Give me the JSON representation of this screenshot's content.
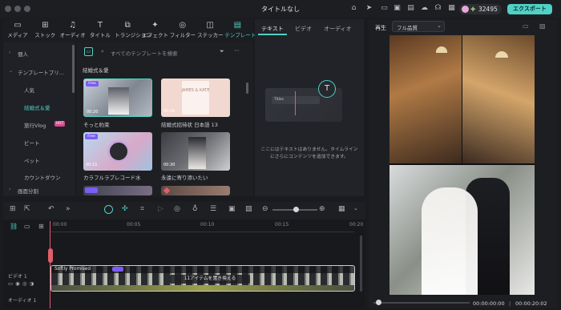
{
  "app": {
    "title": "タイトルなし",
    "credits": "32495",
    "export_label": "エクスポート"
  },
  "toolbar": {
    "items": [
      {
        "label": "メディア",
        "icon": "media-icon"
      },
      {
        "label": "ストック",
        "icon": "stock-icon"
      },
      {
        "label": "オーディオ",
        "icon": "audio-icon"
      },
      {
        "label": "タイトル",
        "icon": "title-icon"
      },
      {
        "label": "トランジション",
        "icon": "transition-icon"
      },
      {
        "label": "エフェクト",
        "icon": "effects-icon"
      },
      {
        "label": "フィルター",
        "icon": "filter-icon"
      },
      {
        "label": "ステッカー",
        "icon": "sticker-icon"
      },
      {
        "label": "テンプレート",
        "icon": "template-icon"
      }
    ]
  },
  "sidebar": {
    "items": [
      "個人",
      "テンプレートプリ...",
      "人気",
      "結婚式＆愛",
      "旅行Vlog",
      "ビート",
      "ペット",
      "カウントダウン",
      "画面分割"
    ],
    "hot_badge": "HOT"
  },
  "search": {
    "placeholder": "すべてのテンプレートを検索"
  },
  "section": {
    "title": "結婚式＆愛"
  },
  "templates": [
    {
      "name": "そっと約束",
      "duration": "00:20",
      "badge": "Free"
    },
    {
      "name": "結婚式招待状 日本語 13",
      "duration": "00:25",
      "card_text": "JAMES & KATE"
    },
    {
      "name": "カラフルラブレコード水",
      "duration": "00:15",
      "badge": "Free"
    },
    {
      "name": "永遠に寄り添いたい",
      "duration": "00:30"
    },
    {
      "name": "",
      "duration": ""
    },
    {
      "name": "",
      "duration": ""
    }
  ],
  "midpanel": {
    "tabs": [
      "テキスト",
      "ビデオ",
      "オーディオ"
    ],
    "empty_line1": "ここにはテキストはありません。タイムライン",
    "empty_line2": "にさらにコンテンツを追加できます。",
    "titles_label": "Titles"
  },
  "preview": {
    "tab": "再生",
    "quality": "フル品質",
    "time_current": "00:00:00:00",
    "time_total": "00:00:20:02"
  },
  "timeline": {
    "marks": [
      "00:00",
      "00:05",
      "00:10",
      "00:15",
      "00:20"
    ],
    "track_label": "ビデオ 1",
    "audio_track_label": "オーディオ 1",
    "clip_label": "Softly Promised",
    "replace_label": "11アイテムを置き換える"
  }
}
